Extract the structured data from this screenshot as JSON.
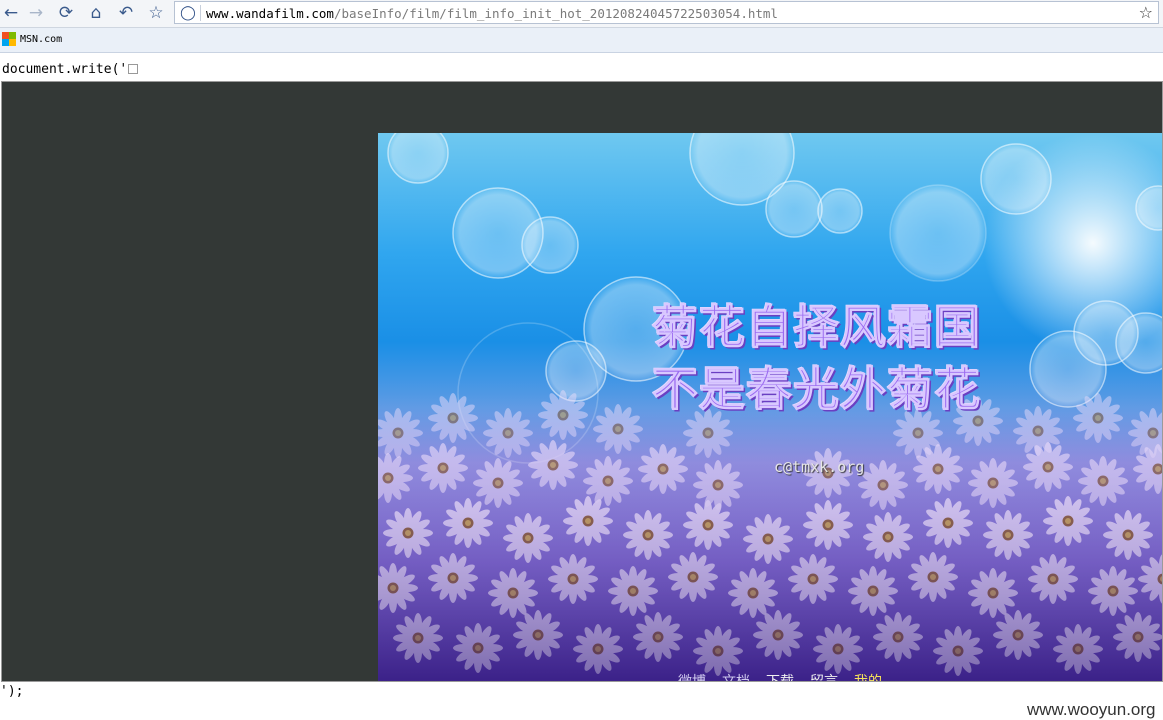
{
  "browser": {
    "url_host": "www.wandafilm.com",
    "url_path": "/baseInfo/film/film_info_init_hot_20120824045722503054.html",
    "bookmarks": [
      {
        "label": "MSN.com"
      }
    ],
    "icons": {
      "back": "back-arrow-icon",
      "forward": "forward-arrow-icon",
      "reload": "reload-icon",
      "home": "home-icon",
      "undo": "undo-icon",
      "favorite": "star-icon",
      "security": "shield-icon"
    }
  },
  "page": {
    "source_top": "document.write('",
    "source_bottom": "');"
  },
  "deface": {
    "line1": "菊花自择风霜国",
    "line2": "不是春光外菊花",
    "email": "c@tmxk.org",
    "footer_links": [
      "微博",
      "文档",
      "下载",
      "留言",
      "我的"
    ]
  },
  "watermark": "www.wooyun.org",
  "colors": {
    "frame_bg": "#333836",
    "poem": "#9b6bf0",
    "sky": "#30a6ef",
    "flowers": "#7a63cf"
  }
}
